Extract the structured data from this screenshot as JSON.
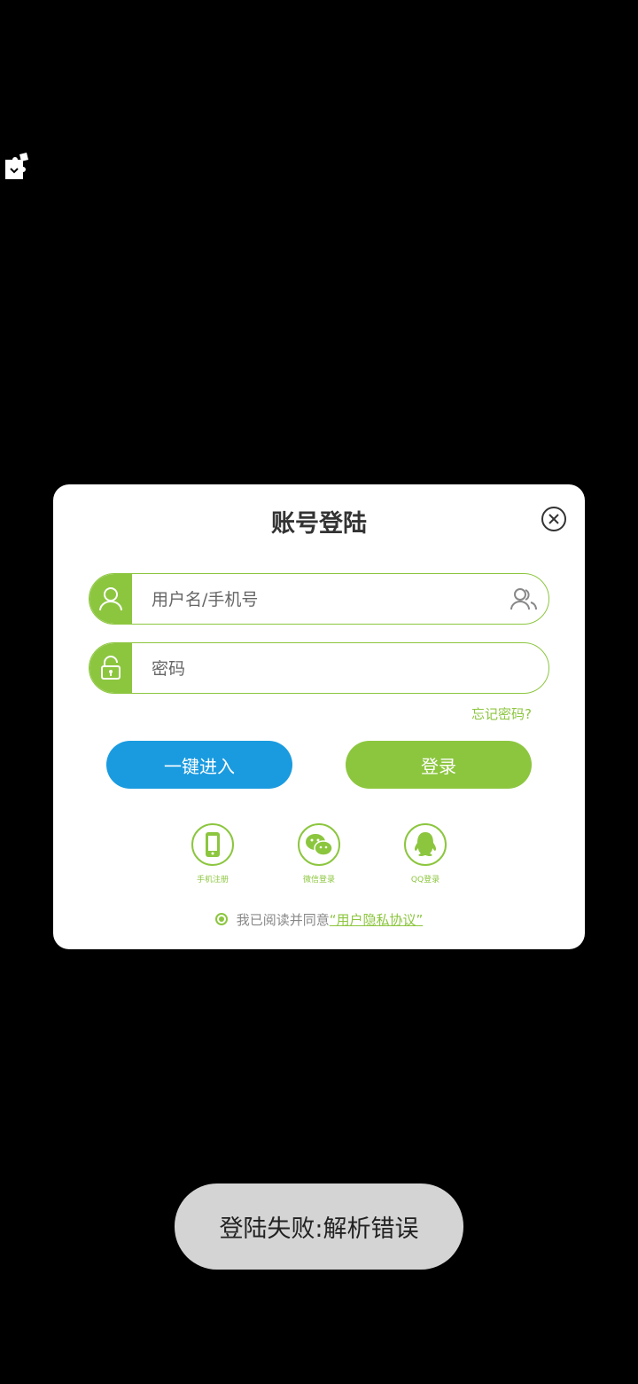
{
  "floating_icon": "puzzle-icon",
  "dialog": {
    "title": "账号登陆",
    "close_icon": "close-circle-icon",
    "username": {
      "placeholder": "用户名/手机号",
      "value": "",
      "icon": "user-icon",
      "switch_icon": "users-icon"
    },
    "password": {
      "placeholder": "密码",
      "value": "",
      "icon": "lock-icon"
    },
    "forgot_label": "忘记密码?",
    "quick_enter_label": "一键进入",
    "login_label": "登录",
    "social": [
      {
        "label": "手机注册",
        "icon": "phone-icon"
      },
      {
        "label": "微信登录",
        "icon": "wechat-icon"
      },
      {
        "label": "QQ登录",
        "icon": "qq-icon"
      }
    ],
    "agreement": {
      "text": "我已阅读并同意",
      "link": "“用户隐私协议”"
    }
  },
  "toast": "登陆失败:解析错误",
  "colors": {
    "accent_green": "#8cc63f",
    "accent_blue": "#1a9be0",
    "background": "#000000",
    "toast_bg": "#d4d4d4"
  }
}
